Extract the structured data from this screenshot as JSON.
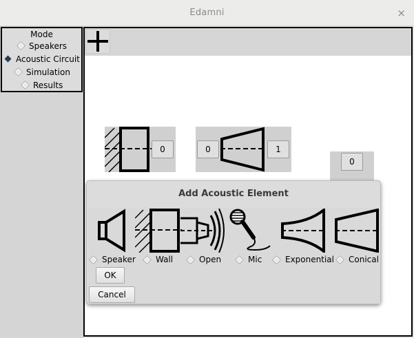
{
  "window": {
    "title": "Edamni",
    "close_glyph": "×"
  },
  "mode_panel": {
    "title": "Mode",
    "options": [
      {
        "label": "Speakers",
        "selected": false
      },
      {
        "label": "Acoustic Circuit",
        "selected": true
      },
      {
        "label": "Simulation",
        "selected": false
      },
      {
        "label": "Results",
        "selected": false
      }
    ]
  },
  "toolbar": {
    "add_icon": "plus-icon"
  },
  "canvas": {
    "wall_block": {
      "port_right": "0"
    },
    "conical_block": {
      "port_left": "0",
      "port_right": "1"
    },
    "partial_block": {
      "port_top": "0"
    }
  },
  "dialog": {
    "title": "Add Acoustic Element",
    "elements": [
      {
        "label": "Speaker",
        "icon": "speaker-icon",
        "selected": false
      },
      {
        "label": "Wall",
        "icon": "wall-icon",
        "selected": false
      },
      {
        "label": "Open",
        "icon": "open-end-icon",
        "selected": false
      },
      {
        "label": "Mic",
        "icon": "mic-icon",
        "selected": false
      },
      {
        "label": "Exponential",
        "icon": "exponential-horn-icon",
        "selected": false
      },
      {
        "label": "Conical",
        "icon": "conical-horn-icon",
        "selected": false
      }
    ],
    "ok_label": "OK",
    "cancel_label": "Cancel"
  }
}
